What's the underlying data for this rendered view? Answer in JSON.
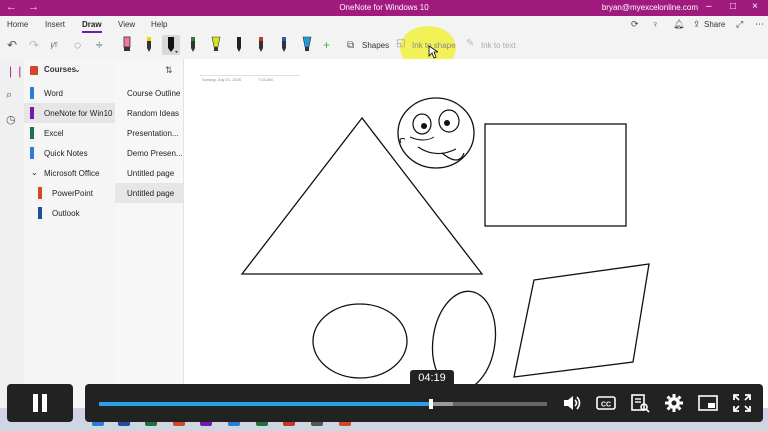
{
  "titlebar": {
    "title": "OneNote for Windows 10",
    "user_email": "bryan@myexcelonline.com",
    "back_icon": "back-arrow-icon",
    "forward_icon": "forward-arrow-icon"
  },
  "menu": {
    "tabs": [
      "Home",
      "Insert",
      "Draw",
      "View",
      "Help"
    ],
    "active_tab": "Draw",
    "share_label": "Share"
  },
  "ribbon": {
    "shapes_label": "Shapes",
    "ink_to_shape_label": "Ink to shape",
    "ink_to_text_label": "Ink to text",
    "pen_colors": [
      "#000000",
      "#ffcc00",
      "#111111",
      "#2f7d32",
      "#d5e21b",
      "#222222",
      "#222222",
      "#c0392b",
      "#1a5fb4",
      "#1f9ad6"
    ]
  },
  "notebooks": {
    "header": "Courses",
    "items": [
      {
        "label": "Word",
        "color": "#2b7cd3"
      },
      {
        "label": "OneNote for Win10",
        "color": "#7719aa"
      },
      {
        "label": "Excel",
        "color": "#1e7145"
      },
      {
        "label": "Quick Notes",
        "color": "#2b7cd3"
      },
      {
        "label": "Microsoft Office",
        "color": ""
      },
      {
        "label": "PowerPoint",
        "color": "#d24726"
      },
      {
        "label": "Outlook",
        "color": "#1f4e9c"
      }
    ]
  },
  "sections": {
    "items": [
      "Course Outline",
      "Random Ideas",
      "Presentation...",
      "Demo Presen...",
      "Untitled page",
      "Untitled page"
    ]
  },
  "page": {
    "date": "Sunday, July 21, 2020",
    "time": "7:23 AM"
  },
  "video": {
    "current_time": "04:19",
    "played_fraction": 0.74,
    "buffered_fraction": 0.79
  },
  "colors": {
    "accent": "#a11b7e",
    "progress": "#2ba0e8"
  }
}
